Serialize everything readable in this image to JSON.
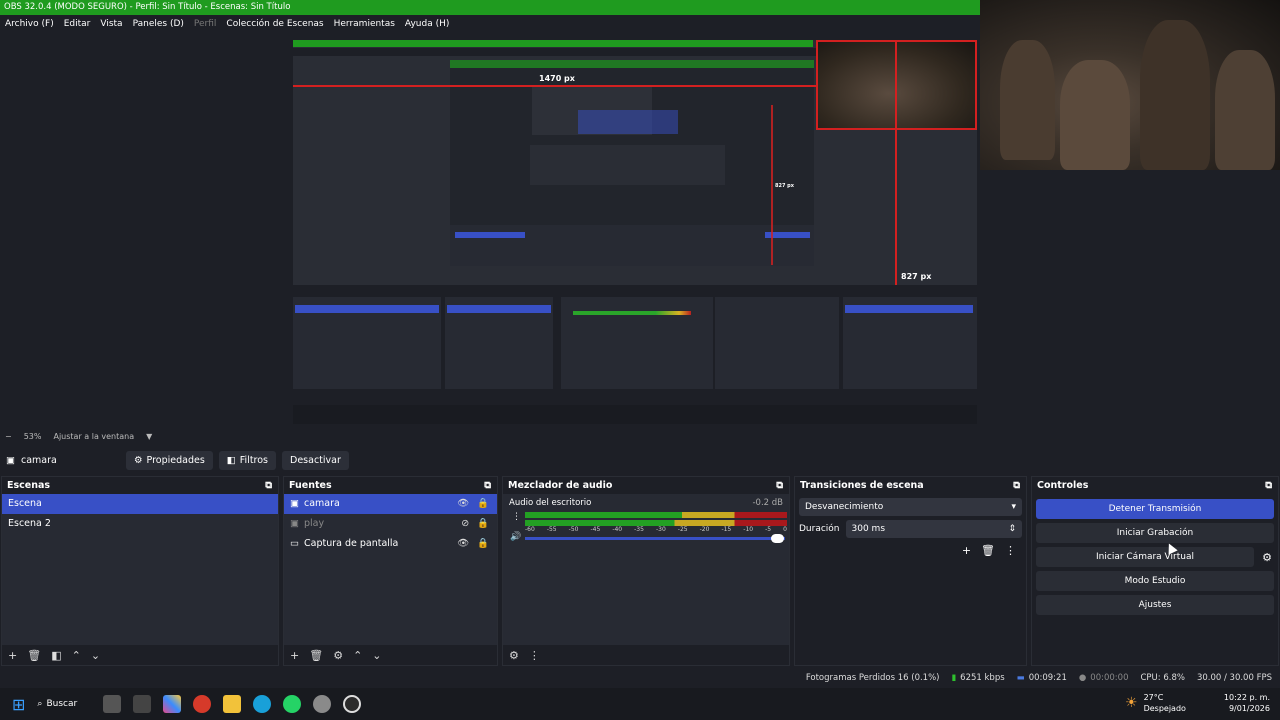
{
  "window": {
    "title": "OBS 32.0.4 (MODO SEGURO) - Perfil: Sin Título - Escenas: Sin Título"
  },
  "menu": [
    "Archivo (F)",
    "Editar",
    "Vista",
    "Paneles (D)",
    "Perfil",
    "Colección de Escenas",
    "Herramientas",
    "Ayuda (H)"
  ],
  "preview": {
    "px_label_top": "1470 px",
    "px_label_right": "827 px",
    "px_label_small": "827 px"
  },
  "zoom": {
    "percent": "53%",
    "fit_label": "Ajustar a la ventana"
  },
  "source_toolbar": {
    "source_name": "camara",
    "properties": "Propiedades",
    "filters": "Filtros",
    "deactivate": "Desactivar"
  },
  "scenes": {
    "title": "Escenas",
    "items": [
      "Escena",
      "Escena 2"
    ],
    "selected": "Escena"
  },
  "sources": {
    "title": "Fuentes",
    "items": [
      {
        "name": "camara",
        "selected": true,
        "visible": true
      },
      {
        "name": "play",
        "selected": false,
        "visible": false
      },
      {
        "name": "Captura de pantalla",
        "selected": false,
        "visible": true
      }
    ]
  },
  "mixer": {
    "title": "Mezclador de audio",
    "channel": "Audio del escritorio",
    "level": "-0.2 dB",
    "scale": [
      "-60",
      "-55",
      "-50",
      "-45",
      "-40",
      "-35",
      "-30",
      "-25",
      "-20",
      "-15",
      "-10",
      "-5",
      "0"
    ]
  },
  "transitions": {
    "title": "Transiciones de escena",
    "selected": "Desvanecimiento",
    "duration_label": "Duración",
    "duration_value": "300 ms"
  },
  "controls": {
    "title": "Controles",
    "stop_stream": "Detener Transmisión",
    "start_recording": "Iniciar Grabación",
    "start_virtual_cam": "Iniciar Cámara Virtual",
    "studio_mode": "Modo Estudio",
    "settings": "Ajustes"
  },
  "status": {
    "dropped_frames": "Fotogramas Perdidos 16 (0.1%)",
    "bitrate": "6251 kbps",
    "stream_time": "00:09:21",
    "rec_time": "00:00:00",
    "cpu": "CPU: 6.8%",
    "fps": "30.00 / 30.00 FPS"
  },
  "taskbar": {
    "search": "Buscar",
    "temp": "27°C",
    "weather": "Despejado",
    "time": "10:22 p. m.",
    "date": "9/01/2026"
  },
  "colors": {
    "accent": "#3850c6",
    "titlebar": "#1f9b1f",
    "highlight": "#d32020"
  }
}
